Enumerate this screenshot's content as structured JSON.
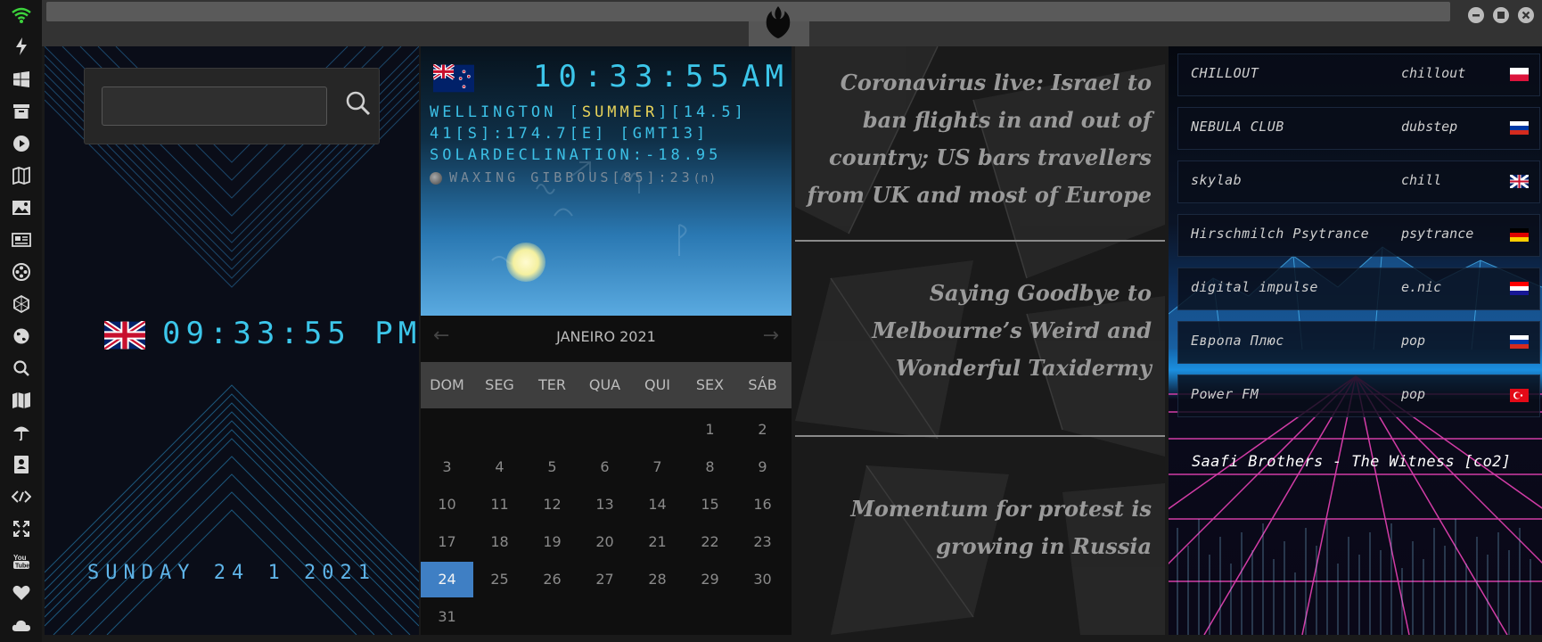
{
  "sidebar": {
    "icons": [
      "wifi-icon",
      "bolt-icon",
      "windows-icon",
      "archive-icon",
      "play-icon",
      "map-book-icon",
      "image-icon",
      "news-icon",
      "film-reel-icon",
      "hexagon-icon",
      "globe-icon",
      "search-icon",
      "map-icon",
      "umbrella-icon",
      "contacts-icon",
      "code-icon",
      "expand-icon",
      "youtube-icon",
      "heart-icon",
      "cloud-icon"
    ]
  },
  "window": {
    "logo": "rebel-alliance-icon",
    "buttons": [
      "minimize-icon",
      "maximize-icon",
      "close-icon"
    ]
  },
  "clock_panel": {
    "flag": "uk-flag",
    "time": "09:33:55 PM",
    "date": "SUNDAY 24 1 2021"
  },
  "weather": {
    "flag": "nz-flag",
    "time": "10:33:55",
    "ampm": "AM",
    "line1_prefix": "WELLINGTON [",
    "season": "SUMMER",
    "line1_suffix": "][14.5]",
    "line2": "41[S]:174.7[E] [GMT13]",
    "line3": "SOLARDECLINATION:-18.95",
    "moon": "WAXING GIBBOUS[85]:23",
    "moon_suffix": "(n)"
  },
  "calendar": {
    "title": "JANEIRO 2021",
    "prev": "←",
    "next": "→",
    "weekdays": [
      "DOM",
      "SEG",
      "TER",
      "QUA",
      "QUI",
      "SEX",
      "SÁB"
    ],
    "first_weekday_index": 5,
    "days_in_month": 31,
    "today": 24
  },
  "news": {
    "items": [
      "Coronavirus live: Israel to ban flights in and out of country; US bars travellers from UK and most of Europe",
      "Saying Goodbye to Melbourne’s Weird and Wonderful Taxidermy",
      "Momentum for protest is growing in Russia"
    ]
  },
  "radio": {
    "stations": [
      {
        "name": "CHILLOUT",
        "genre": "chillout",
        "flag": "poland-flag",
        "colors": [
          "#ffffff",
          "#dc143c"
        ]
      },
      {
        "name": "NEBULA CLUB",
        "genre": "dubstep",
        "flag": "russia-flag",
        "colors": [
          "#ffffff",
          "#0039a6",
          "#d52b1e"
        ]
      },
      {
        "name": "skylab",
        "genre": "chill",
        "flag": "uk-flag",
        "colors": [
          "#012169",
          "#ffffff",
          "#c8102e"
        ]
      },
      {
        "name": "Hirschmilch Psytrance",
        "genre": "psytrance",
        "flag": "germany-flag",
        "colors": [
          "#000000",
          "#dd0000",
          "#ffce00"
        ]
      },
      {
        "name": "digital impulse",
        "genre": "e.nic",
        "flag": "croatia-flag",
        "colors": [
          "#ff0000",
          "#ffffff",
          "#171796"
        ]
      },
      {
        "name": "Европа Плюс",
        "genre": "pop",
        "flag": "russia-flag",
        "colors": [
          "#ffffff",
          "#0039a6",
          "#d52b1e"
        ]
      },
      {
        "name": "Power FM",
        "genre": "pop",
        "flag": "turkey-flag",
        "colors": [
          "#e30a17"
        ]
      }
    ],
    "now_playing": "Saafi Brothers - The Witness [co2]"
  }
}
